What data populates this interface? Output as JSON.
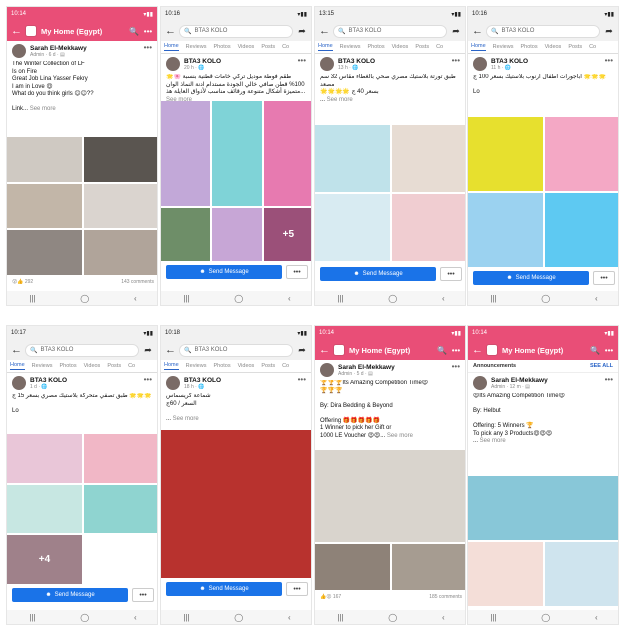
{
  "icons": {
    "back": "←",
    "search": "🔍",
    "more": "•••",
    "share": "➦",
    "nav_recents": "|||",
    "nav_home": "◯",
    "nav_back": "‹",
    "msg": "☻"
  },
  "colors": {
    "group_bar": "#e94e77",
    "tab_active": "#2a64c7",
    "send_button": "#1a73e8"
  },
  "phones": [
    {
      "time": "10:14",
      "type": "group",
      "title": "My Home (Egypt)",
      "author": "Sarah El-Mekkawy",
      "meta": "Admin · 6 d · ▤",
      "text": "The Winter Collection of LF\nIs on Fire\nGreat Job Lina Yasser Fekry\nI am in Love 😍\nWhat do you think girls 😊😊??\n\nLink... ",
      "see_more": "See more",
      "tiles": [
        {
          "c": "#cfc9c2"
        },
        {
          "c": "#5a5550"
        },
        {
          "c": "#c2b6a8"
        },
        {
          "c": "#dad4cf"
        },
        {
          "c": "#8f8782"
        },
        {
          "c": "#b0a49a"
        }
      ],
      "reactions_left": "😮👍 292",
      "reactions_right": "143 comments",
      "has_msg": false
    },
    {
      "time": "10:16",
      "type": "page",
      "search": "BTA3 KOLO",
      "tabs": [
        "Home",
        "Reviews",
        "Photos",
        "Videos",
        "Posts",
        "Co"
      ],
      "author": "BTA3 KOLO",
      "meta": "20 h · 🌐",
      "text": "🌟🌸 طقم فوطة موديل تركي خامات قطنية بنسبة 100% قطن صافي خالي الجودة مستدام ادنة النماذ الوان متميزة أشكال متنوعة ورقائف مناسب لأذواق العايلة هذ... ",
      "see_more": "See more",
      "tiles": [
        {
          "c": "#c2a8d8"
        },
        {
          "c": "#7fd3d7"
        },
        {
          "c": "#e77ab0"
        },
        {
          "c": "#6e8e68"
        },
        {
          "c": "#c7a6d6"
        },
        {
          "c": "#ee7cbb"
        }
      ],
      "overlay": "+5",
      "send": "Send Message",
      "has_msg": true
    },
    {
      "time": "13:15",
      "type": "page",
      "search": "BTA3 KOLO",
      "tabs": [
        "Home",
        "Reviews",
        "Photos",
        "Videos",
        "Posts",
        "Co"
      ],
      "author": "BTA3 KOLO",
      "meta": "13 h · 🌐",
      "text": "طبق تورتة بلاستيك مصري صحي بالغطاء مقاس 32 سم مصعد\n🌟🌟🌟🌟 بسعر 40 ج\n... ",
      "see_more": "See more",
      "tiles": [
        {
          "c": "#bfe2ea"
        },
        {
          "c": "#e7dcd3"
        },
        {
          "c": "#d8ebf2"
        },
        {
          "c": "#f0cdd1"
        },
        {
          "c": "#efe4c4"
        },
        {
          "c": "#9dd0e4"
        }
      ],
      "overlay": "+2",
      "send": "Send Message",
      "has_msg": true
    },
    {
      "time": "10:16",
      "type": "page",
      "search": "BTA3 KOLO",
      "tabs": [
        "Home",
        "Reviews",
        "Photos",
        "Videos",
        "Posts",
        "Co"
      ],
      "author": "BTA3 KOLO",
      "meta": "11 h · 🌐",
      "text": "اباجورات اطفال ارنوب بلاستيك بسعر 100 ج 🌟🌟🌟\n\nLo",
      "see_more": "",
      "tiles": [
        {
          "c": "#e7e02e"
        },
        {
          "c": "#f4a8c5"
        },
        {
          "c": "#9bd2f0"
        },
        {
          "c": "#5ec9f2"
        }
      ],
      "send": "Send Message",
      "has_msg": true
    },
    {
      "time": "10:17",
      "type": "page",
      "search": "BTA3 KOLO",
      "tabs": [
        "Home",
        "Reviews",
        "Photos",
        "Videos",
        "Posts",
        "Co"
      ],
      "author": "BTA3 KOLO",
      "meta": "1 d · 🌐",
      "text": "طبق تصفي متحركة بلاستيك مصري بسعر 15 ج 🌟🌟🌟\n\nLo",
      "see_more": "",
      "tiles": [
        {
          "c": "#e9c6d8"
        },
        {
          "c": "#f1b7c6"
        },
        {
          "c": "#c7e7e2"
        },
        {
          "c": "#8fd4d0"
        },
        {
          "c": "#f4c6d5"
        }
      ],
      "overlay": "+4",
      "send": "Send Message",
      "has_msg": true
    },
    {
      "time": "10:18",
      "type": "page",
      "search": "BTA3 KOLO",
      "tabs": [
        "Home",
        "Reviews",
        "Photos",
        "Videos",
        "Posts",
        "Co"
      ],
      "author": "BTA3 KOLO",
      "meta": "18 h · 🌐",
      "text": "شماعة كريسماس\nالسعر / 60ج\n\n... ",
      "see_more": "See more",
      "tiles": [
        {
          "c": "#b8322e"
        }
      ],
      "send": "Send Message",
      "has_msg": true
    },
    {
      "time": "10:14",
      "type": "group",
      "title": "My Home (Egypt)",
      "author": "Sarah El-Mekkawy",
      "meta": "Admin · 5 d · ▤",
      "text": "🏆🏆🏆Its Amazing Competition Time😍\n🏆🏆🏆\n\nBy: Dira Bedding & Beyond\n\nOffering 🎁🎁🎁🎁🎁\n1 Winner to pick her Gift or\n1000 LE Voucher 😍😍... ",
      "see_more": "See more",
      "tiles": [
        {
          "c": "#d9d4cd"
        },
        {
          "c": "#8e8278"
        },
        {
          "c": "#a69c91"
        }
      ],
      "reactions_left": "👍😮 167",
      "reactions_right": "185 comments",
      "has_msg": false
    },
    {
      "time": "10:14",
      "type": "group-ann",
      "title": "My Home (Egypt)",
      "ann_label": "Announcements",
      "ann_see": "SEE ALL",
      "author": "Sarah El-Mekkawy",
      "meta": "Admin · 12 m · ▤",
      "text": "😍Its Amazing Competition Time😍\n\nBy: Helbut\n\nOffering: 5 Winners 🏆\nTo pick any 3 Products😍😍😍\n... ",
      "see_more": "See more",
      "tiles": [
        {
          "c": "#88c7d8"
        },
        {
          "c": "#f4ded8"
        },
        {
          "c": "#cfe4ee"
        }
      ],
      "has_msg": false
    }
  ]
}
